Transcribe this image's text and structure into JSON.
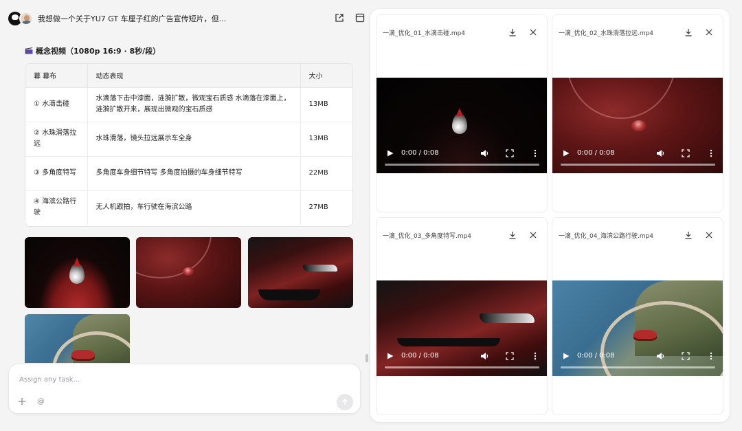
{
  "header": {
    "title": "我想做一个关于YU7 GT 车厘子红的广告宣传短片，但..."
  },
  "section": {
    "title": "概念视频（1080p 16:9 · 8秒/段）"
  },
  "table": {
    "headers": [
      "幕 幕布",
      "动态表现",
      "大小"
    ],
    "rows": [
      {
        "scene": "① 水滴击碰",
        "desc": "水滴落下击中漆面，涟漪扩散，微观宝石质感  水滴落在漆面上，涟漪扩散开来，展现出微观的宝石质感",
        "size": "13MB"
      },
      {
        "scene": "② 水珠滑落拉远",
        "desc": "水珠滑落，镜头拉远展示车全身",
        "size": "13MB"
      },
      {
        "scene": "③ 多角度特写",
        "desc": "多角度车身细节特写  多角度拍摄的车身细节特写",
        "size": "22MB"
      },
      {
        "scene": "④ 海滨公路行驶",
        "desc": "无人机跟拍，车行驶在海滨公路",
        "size": "27MB"
      }
    ]
  },
  "input": {
    "placeholder": "Assign any task..."
  },
  "videos": [
    {
      "filename": "一滴_优化_01_水滴击碰.mp4",
      "time": "0:00 / 0:08",
      "scene": "drop"
    },
    {
      "filename": "一滴_优化_02_水珠滑落拉远.mp4",
      "time": "0:00 / 0:08",
      "scene": "slide"
    },
    {
      "filename": "一滴_优化_03_多角度特写.mp4",
      "time": "0:00 / 0:08",
      "scene": "car"
    },
    {
      "filename": "一滴_优化_04_海滨公路行驶.mp4",
      "time": "0:00 / 0:08",
      "scene": "road"
    }
  ],
  "icons": {
    "header": [
      "avatar",
      "share-icon",
      "panel-icon"
    ],
    "video_card": [
      "download-icon",
      "close-icon",
      "play-icon",
      "volume-icon",
      "fullscreen-icon",
      "more-icon"
    ],
    "input": [
      "plus-icon",
      "at-icon",
      "send-icon"
    ]
  },
  "colors": {
    "accent_red": "#8b1e1e",
    "background": "#f4f4f5",
    "panel": "#ffffff"
  }
}
